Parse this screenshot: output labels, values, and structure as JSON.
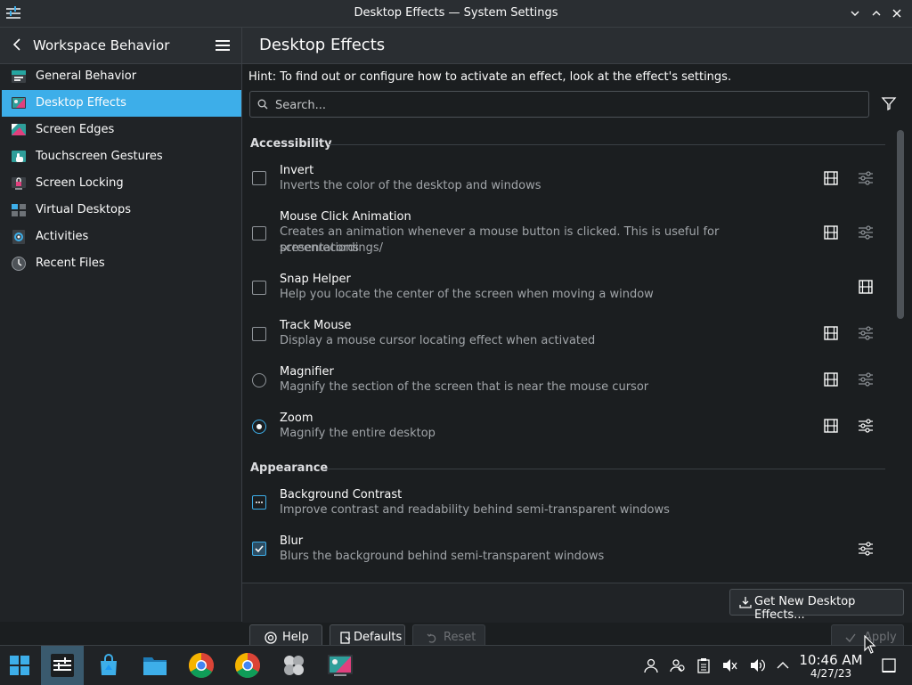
{
  "window": {
    "title": "Desktop Effects — System Settings"
  },
  "sidebar": {
    "title": "Workspace Behavior",
    "items": [
      {
        "label": "General Behavior",
        "icon": "general-behavior-icon"
      },
      {
        "label": "Desktop Effects",
        "icon": "desktop-effects-icon"
      },
      {
        "label": "Screen Edges",
        "icon": "screen-edges-icon"
      },
      {
        "label": "Touchscreen Gestures",
        "icon": "touchscreen-gestures-icon"
      },
      {
        "label": "Screen Locking",
        "icon": "screen-locking-icon"
      },
      {
        "label": "Virtual Desktops",
        "icon": "virtual-desktops-icon"
      },
      {
        "label": "Activities",
        "icon": "activities-icon"
      },
      {
        "label": "Recent Files",
        "icon": "recent-files-icon"
      }
    ],
    "selected": "Desktop Effects"
  },
  "main": {
    "title": "Desktop Effects",
    "hint": "Hint: To find out or configure how to activate an effect, look at the effect's settings.",
    "search_placeholder": "Search...",
    "sections": [
      {
        "title": "Accessibility",
        "effects": [
          {
            "name": "Invert",
            "description": "Inverts the color of the desktop and windows",
            "control": "checkbox",
            "checked": false
          },
          {
            "name": "Mouse Click Animation",
            "description_line1": "Creates an animation whenever a mouse button is clicked. This is useful for screenrecordings/",
            "description_line2": "presentations",
            "control": "checkbox",
            "checked": false
          },
          {
            "name": "Snap Helper",
            "description": "Help you locate the center of the screen when moving a window",
            "control": "checkbox",
            "checked": false
          },
          {
            "name": "Track Mouse",
            "description": "Display a mouse cursor locating effect when activated",
            "control": "checkbox",
            "checked": false
          },
          {
            "name": "Magnifier",
            "description": "Magnify the section of the screen that is near the mouse cursor",
            "control": "radio",
            "checked": false
          },
          {
            "name": "Zoom",
            "description": "Magnify the entire desktop",
            "control": "radio",
            "checked": true
          }
        ]
      },
      {
        "title": "Appearance",
        "effects": [
          {
            "name": "Background Contrast",
            "description": "Improve contrast and readability behind semi-transparent windows",
            "control": "checkbox",
            "checked": "partial"
          },
          {
            "name": "Blur",
            "description": "Blurs the background behind semi-transparent windows",
            "control": "checkbox",
            "checked": true
          }
        ]
      }
    ]
  },
  "footer": {
    "get_new": "Get New Desktop Effects...",
    "help": "Help",
    "defaults": "Defaults",
    "reset": "Reset",
    "apply": "Apply"
  },
  "taskbar": {
    "time": "10:46 AM",
    "date": "4/27/23",
    "apps": [
      "start-menu-icon",
      "system-settings-icon",
      "discover-store-icon",
      "file-manager-icon",
      "chrome-icon",
      "chrome-icon",
      "steam-link-icon",
      "desktop-effects-app-icon"
    ],
    "tray": [
      "user-icon",
      "users-icon",
      "clipboard-icon",
      "volume-muted-icon",
      "volume-icon",
      "expand-tray-icon"
    ]
  },
  "colors": {
    "accent": "#3daee9",
    "background": "#1b1e20",
    "sidebar": "#202326",
    "header": "#2a2e32"
  }
}
